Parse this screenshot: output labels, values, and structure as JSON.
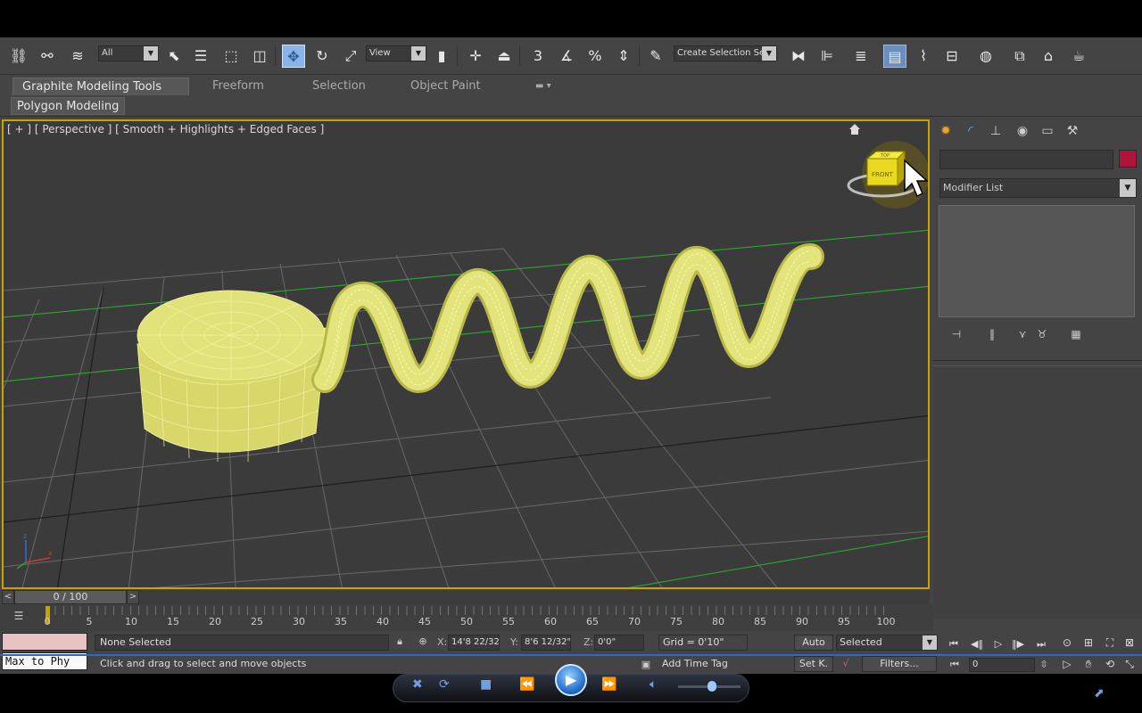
{
  "toolbar": {
    "filter_value": "All",
    "ref_coord_value": "View",
    "snap_3": "3",
    "snap_percent": "%",
    "selection_set_value": "Create Selection Se"
  },
  "ribbon": {
    "tabs": [
      {
        "label": "Graphite Modeling Tools"
      },
      {
        "label": "Freeform"
      },
      {
        "label": "Selection"
      },
      {
        "label": "Object Paint"
      }
    ],
    "panel_label": "Polygon Modeling"
  },
  "viewport": {
    "label": "[ + ] [ Perspective ] [ Smooth + Highlights + Edged Faces ]",
    "viewcube_face": "FRONT",
    "viewcube_top": "TOP",
    "axis_z": "z",
    "axis_x": "x",
    "object_color": "#dede6a",
    "border_color": "#c9a400"
  },
  "command_panel": {
    "tabs": [
      {
        "icon": "create-icon"
      },
      {
        "icon": "modify-icon"
      },
      {
        "icon": "hierarchy-icon"
      },
      {
        "icon": "motion-icon"
      },
      {
        "icon": "display-icon"
      },
      {
        "icon": "utilities-icon"
      }
    ],
    "name_value": "",
    "color": "#b0143a",
    "modifier_list_label": "Modifier List"
  },
  "time_slider": {
    "frame_display": "0 / 100",
    "prev": "<",
    "next": ">"
  },
  "trackbar": {
    "ticks": [
      "0",
      "5",
      "10",
      "15",
      "20",
      "25",
      "30",
      "35",
      "40",
      "45",
      "50",
      "55",
      "60",
      "65",
      "70",
      "75",
      "80",
      "85",
      "90",
      "95",
      "100"
    ]
  },
  "status": {
    "maxscript_text": "Max to Phy",
    "selection_info": "None Selected",
    "prompt": "Click and drag to select and move objects",
    "x_label": "X:",
    "x_value": "14'8 22/32\"",
    "y_label": "Y:",
    "y_value": "8'6 12/32\"",
    "z_label": "Z:",
    "z_value": "0'0\"",
    "grid": "Grid = 0'10\"",
    "add_time_tag": "Add Time Tag",
    "auto_key": "Auto",
    "selected": "Selected",
    "set_key": "Set K.",
    "filters": "Filters...",
    "current_frame": "0"
  }
}
